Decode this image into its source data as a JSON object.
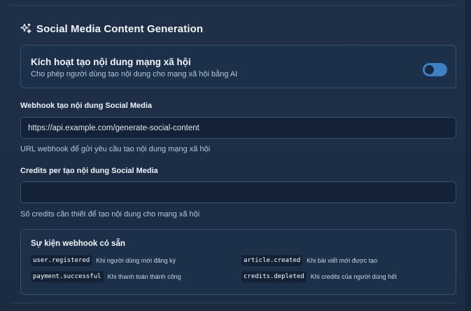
{
  "section": {
    "icon": "sparkle-icon",
    "title": "Social Media Content Generation"
  },
  "toggle": {
    "title": "Kích hoạt tạo nội dung mạng xã hội",
    "description": "Cho phép người dùng tạo nội dung cho mạng xã hội bằng AI",
    "enabled": false,
    "track_color": "#3b82c4"
  },
  "webhook": {
    "label": "Webhook tạo nội dung Social Media",
    "value": "https://api.example.com/generate-social-content",
    "help": "URL webhook để gửi yêu cầu tạo nội dung mạng xã hội"
  },
  "credits": {
    "label": "Credits per tạo nội dung Social Media",
    "value": "",
    "help": "Số credits cần thiết để tạo nội dung cho mạng xã hội"
  },
  "events": {
    "title": "Sự kiện webhook có sẵn",
    "items": [
      {
        "code": "user.registered",
        "desc": "Khi người dùng mới đăng ký"
      },
      {
        "code": "article.created",
        "desc": "Khi bài viết mới được tạo"
      },
      {
        "code": "payment.successful",
        "desc": "Khi thanh toán thành công"
      },
      {
        "code": "credits.depleted",
        "desc": "Khi credits của người dùng hết"
      }
    ]
  }
}
